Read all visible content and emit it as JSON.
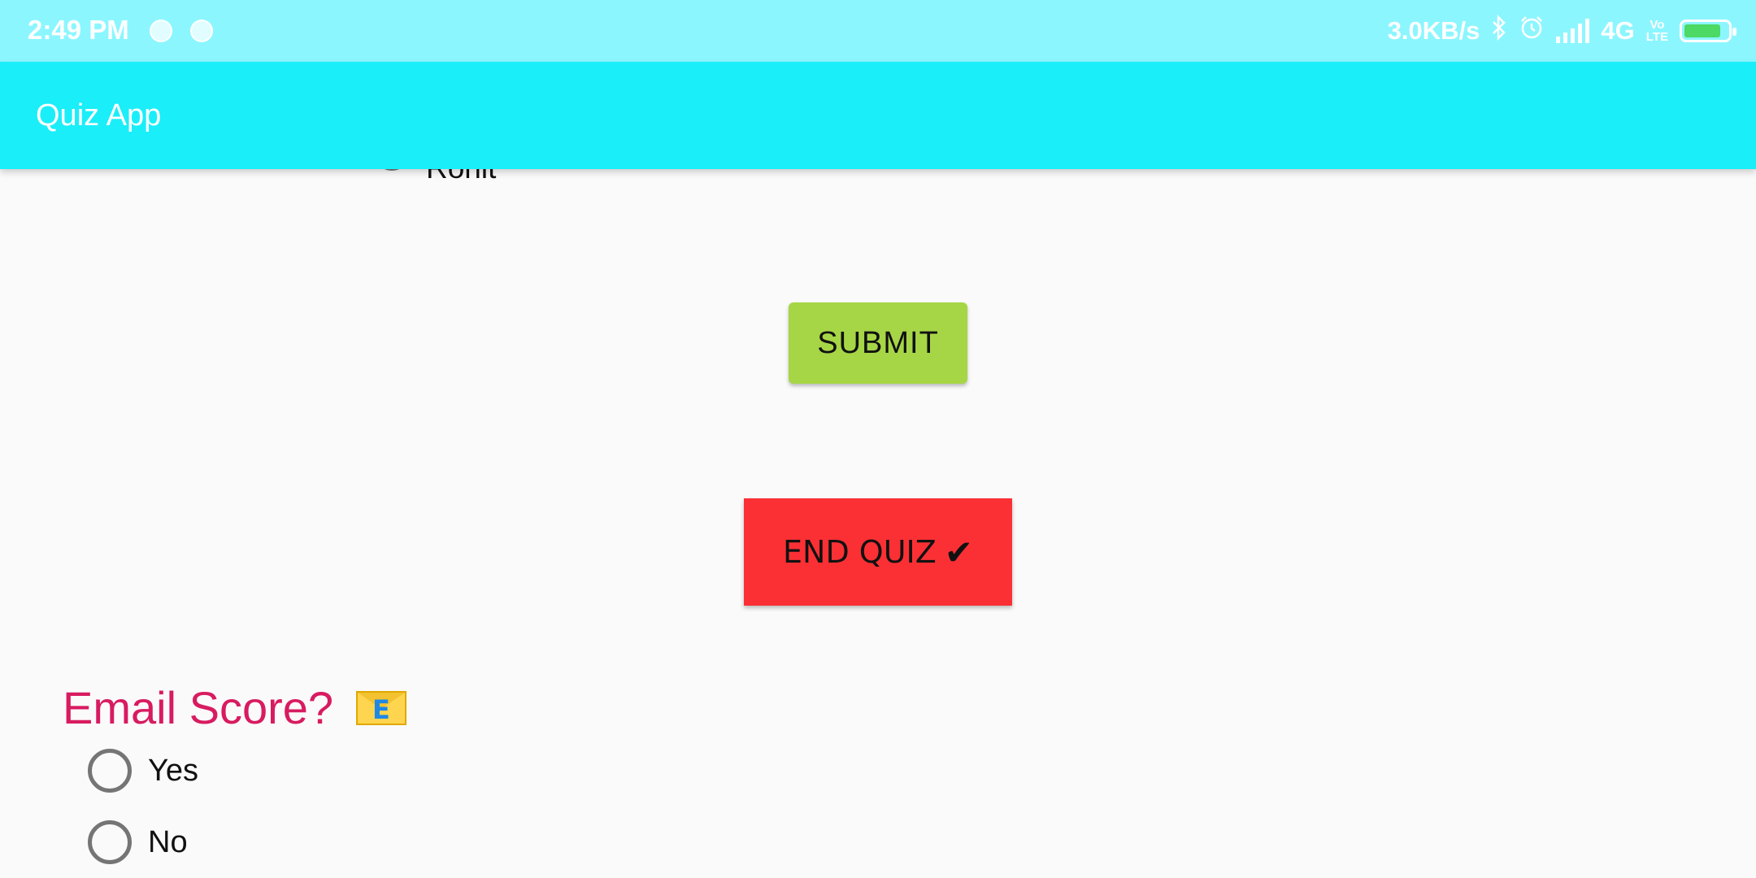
{
  "status_bar": {
    "time": "2:49 PM",
    "net_speed": "3.0KB/s",
    "network_type": "4G",
    "volte_top": "Vo",
    "volte_bottom": "LTE",
    "battery_color": "#4cd964"
  },
  "app_bar": {
    "title": "Quiz App",
    "color": "#1aeef9"
  },
  "previous_question": {
    "partial_option_label": "Rohit"
  },
  "buttons": {
    "submit_label": "SUBMIT",
    "end_quiz_label": "END QUIZ",
    "end_quiz_icon": "✔"
  },
  "email_section": {
    "title": "Email Score?",
    "icon_letter": "E",
    "options": [
      {
        "label": "Yes",
        "selected": false
      },
      {
        "label": "No",
        "selected": false
      }
    ]
  }
}
